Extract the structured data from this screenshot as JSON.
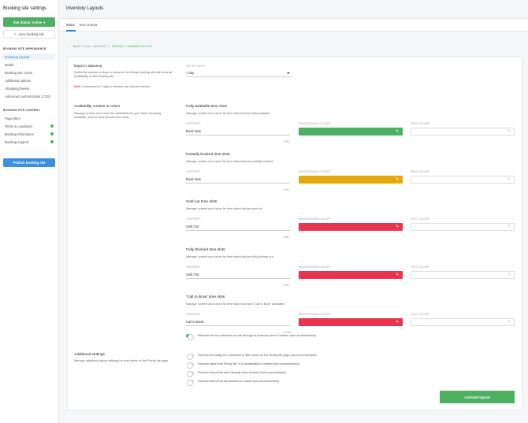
{
  "sidebar": {
    "title": "Booking site settings",
    "status_button": "Site Status: Active",
    "view_button": "View booking site",
    "appearance_heading": "BOOKING SITE APPEARANCE",
    "appearance_items": [
      {
        "label": "Inventory layouts"
      },
      {
        "label": "Media"
      },
      {
        "label": "Booking site colors"
      },
      {
        "label": "Additional options"
      },
      {
        "label": "Shopping basket"
      },
      {
        "label": "Advanced customization (CSS)"
      }
    ],
    "content_heading": "BOOKING SITE CONTENT",
    "content_items": [
      {
        "label": "Page titles"
      },
      {
        "label": "Terms & conditions"
      },
      {
        "label": "Booking information"
      },
      {
        "label": "Booking support"
      }
    ],
    "publish_button": "Publish booking site"
  },
  "header": {
    "title": "Inventory Layouts",
    "tabs": [
      {
        "label": "Items"
      },
      {
        "label": "Item Extras"
      }
    ]
  },
  "back_link": {
    "prefix": "BACK TO ALL LAYOUTS",
    "current": "DEFAULT • SUMMER ACTIVE"
  },
  "days_in_advance": {
    "title": "Days in advance",
    "description": "Select the number of days in advance the Rezdy booking site will show all availability on the booking site.",
    "note_label": "Note:",
    "note_text": "A maximum of 7 days in advance can only be selected.",
    "field_label": "NO. OF DAYS",
    "value": "7 day"
  },
  "availability": {
    "title": "Availability content & colors",
    "description": "Manage content and colors for availability for your times including available, sold out and blocked time slots.",
    "labels": {
      "content": "CONTENT",
      "background": "BACKGROUND COLOR",
      "text": "TEXT COLOR"
    },
    "groups": [
      {
        "title": "Fully available time slots",
        "desc": "Manage content and colors for time slots that are fully available.",
        "content": "Book Now",
        "count": "8/30",
        "bg": "#4caf62"
      },
      {
        "title": "Partially booked time slots",
        "desc": "Manage content and colors for time slots that are partially booked.",
        "content": "Book Now",
        "count": "8/30",
        "bg": "#e5a90e"
      },
      {
        "title": "Sold out time slots",
        "desc": "Manage content and colors for time slots that are sold out.",
        "content": "Sold Out",
        "count": "8/30",
        "bg": "#e8344f"
      },
      {
        "title": "Fully blocked time slots",
        "desc": "Manage content and colors for time slots that are fully blocked out.",
        "content": "Sold Out",
        "count": "8/30",
        "bg": "#e8344f"
      },
      {
        "title": "'Call to Book' time slots",
        "desc": "Manage content and colors for time slots that have 'Call to Book' activated.",
        "content": "Call to Book",
        "count": "12/30",
        "bg": "#e8344f"
      }
    ],
    "toggle_label": "Remove link for customers to call through to business phone number (not recommended)"
  },
  "additional": {
    "title": "Additional settings",
    "description": "Manage additional layout settings for your items on the Rezdy list page.",
    "toggles": [
      {
        "label": "Remove the ability for customers to filter items on the Rezdy list page (not recommended)"
      },
      {
        "label": "Remove days from Rezdy list, if no availability is created (not recommended)"
      },
      {
        "label": "Remove times that have already been booked (not recommended)"
      },
      {
        "label": "Remove times that are blocked or closed (not recommended)"
      }
    ]
  },
  "activate_button": "Activate layout",
  "colors": {
    "accent_blue": "#3d8fe0",
    "accent_green": "#4caf62",
    "warning_yellow": "#e5a90e",
    "danger_red": "#e8344f"
  }
}
